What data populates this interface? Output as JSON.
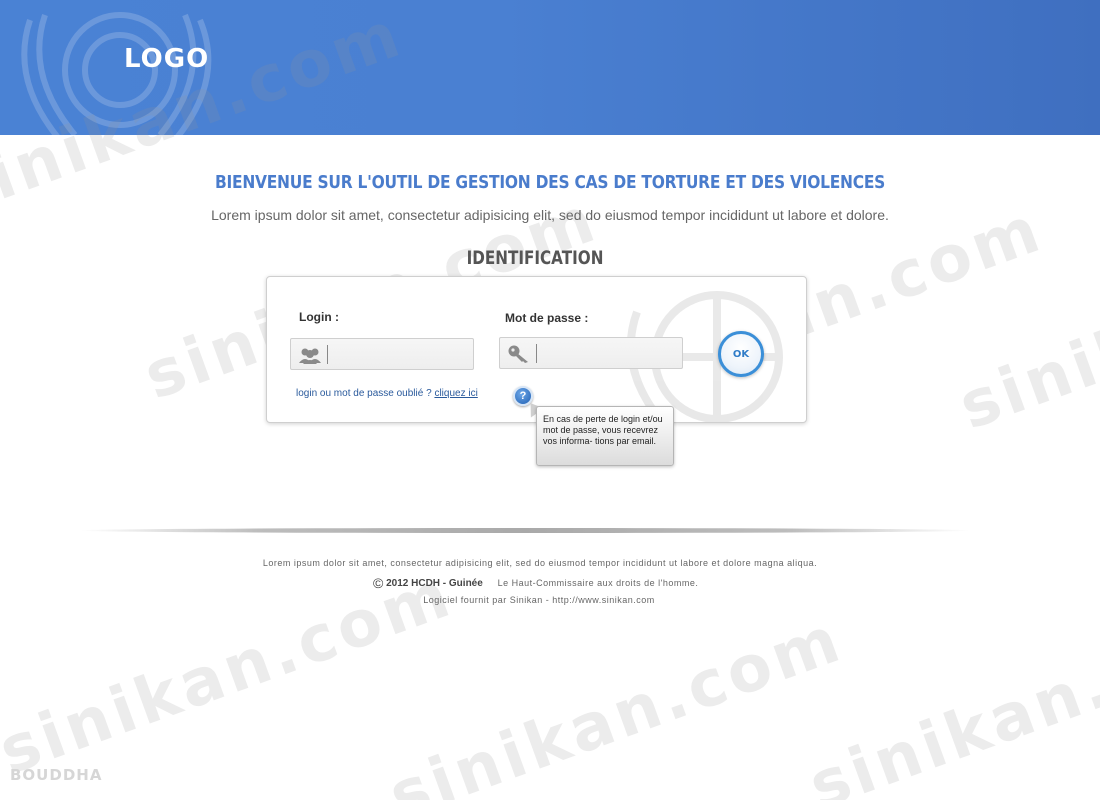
{
  "header": {
    "logo": "LOGO"
  },
  "main": {
    "title": "BIENVENUE SUR L'OUTIL DE GESTION DES CAS DE TORTURE ET DES VIOLENCES",
    "intro": "Lorem ipsum dolor sit amet, consectetur adipisicing elit, sed do eiusmod tempor incididunt ut labore et dolore."
  },
  "login_form": {
    "section_title": "IDENTIFICATION",
    "login_label": "Login :",
    "login_value": "",
    "password_label": "Mot de passe :",
    "password_value": "",
    "login_icon": "users-icon",
    "password_icon": "key-icon",
    "ok_label": "OK",
    "forgot_text": "login ou mot de passe oublié ? ",
    "forgot_link": "cliquez ici",
    "help_icon": "question-icon",
    "tooltip_text": "En cas de perte de login et/ou mot de passe, vous recevrez vos informa- tions par email."
  },
  "footer": {
    "line1": "Lorem ipsum dolor sit amet, consectetur adipisicing elit, sed do eiusmod tempor incididunt ut labore et dolore magna aliqua.",
    "copyright_symbol": "©",
    "owner": "2012 HCDH - Guinée",
    "tagline": "Le Haut-Commissaire aux droits de l'homme.",
    "line3": "Logiciel fournit par Sinikan - http://www.sinikan.com"
  },
  "watermark_text": "sinikan.com",
  "signature": "BOUDDHA",
  "colors": {
    "header_blue": "#4a80d2",
    "title_blue": "#4a7ccc",
    "ok_ring": "#3b8fd8",
    "link": "#2a5a9c"
  }
}
